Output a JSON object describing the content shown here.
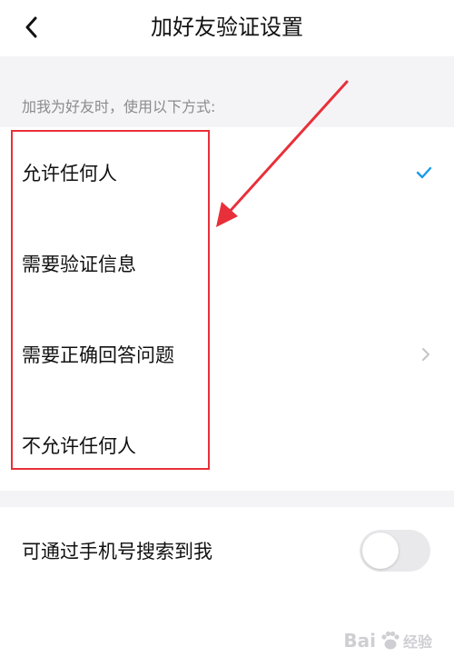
{
  "header": {
    "title": "加好友验证设置",
    "back_icon": "chevron-left-icon"
  },
  "section": {
    "header": "加我为好友时，使用以下方式:"
  },
  "options": [
    {
      "label": "允许任何人",
      "selected": true,
      "trailing": "check-icon"
    },
    {
      "label": "需要验证信息",
      "selected": false,
      "trailing": ""
    },
    {
      "label": "需要正确回答问题",
      "selected": false,
      "trailing": "chevron-right-icon"
    },
    {
      "label": "不允许任何人",
      "selected": false,
      "trailing": ""
    }
  ],
  "phone_search": {
    "label": "可通过手机号搜索到我",
    "enabled": false
  },
  "annotation": {
    "color": "#e8303a"
  },
  "watermark": {
    "text": "Bai",
    "text_after": "经验",
    "color": "#c9c9cf"
  },
  "colors": {
    "accent": "#1a9be8",
    "chevron": "#c4c4c8",
    "band": "#f4f4f6"
  }
}
